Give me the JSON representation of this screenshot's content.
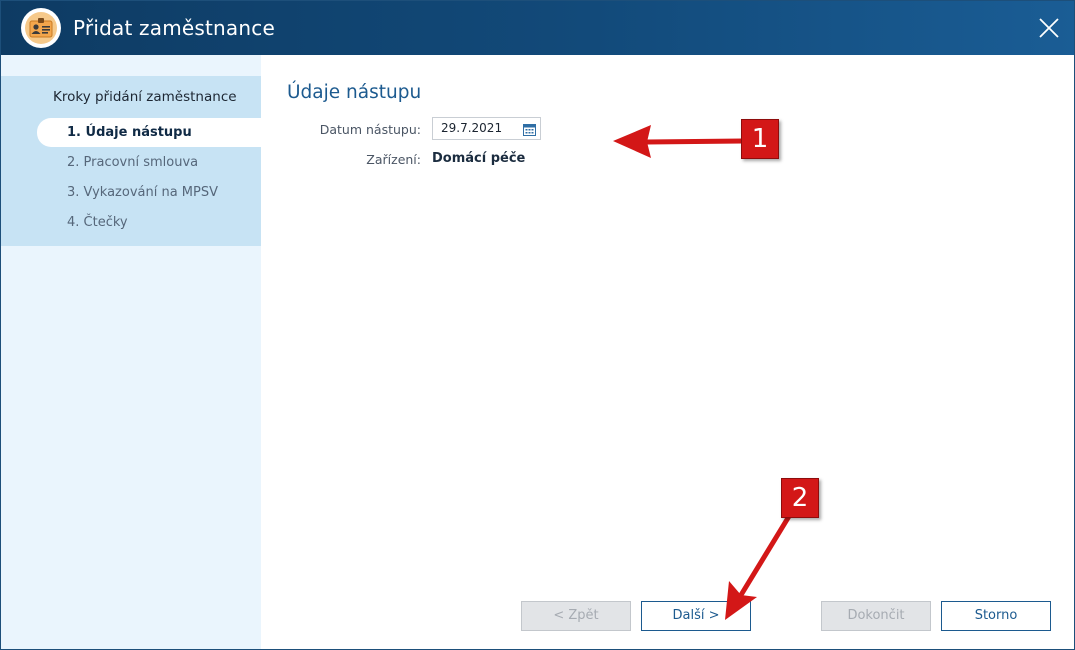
{
  "window": {
    "title": "Přidat zaměstnance"
  },
  "sidebar": {
    "heading": "Kroky přidání zaměstnance",
    "steps": [
      {
        "label": "1. Údaje nástupu",
        "active": true
      },
      {
        "label": "2. Pracovní smlouva",
        "active": false
      },
      {
        "label": "3. Vykazování na MPSV",
        "active": false
      },
      {
        "label": "4. Čtečky",
        "active": false
      }
    ]
  },
  "main": {
    "heading": "Údaje nástupu",
    "start_date_label": "Datum nástupu:",
    "start_date_value": "29.7.2021",
    "facility_label": "Zařízení:",
    "facility_value": "Domácí péče"
  },
  "footer": {
    "back_label": "< Zpět",
    "next_label": "Další >",
    "finish_label": "Dokončit",
    "cancel_label": "Storno"
  },
  "annotations": {
    "badge1": "1",
    "badge2": "2",
    "color": "#d31717"
  },
  "colors": {
    "titlebar": "#124a7a",
    "accent": "#1c5a8f",
    "sidebar": "#c7e3f4"
  }
}
